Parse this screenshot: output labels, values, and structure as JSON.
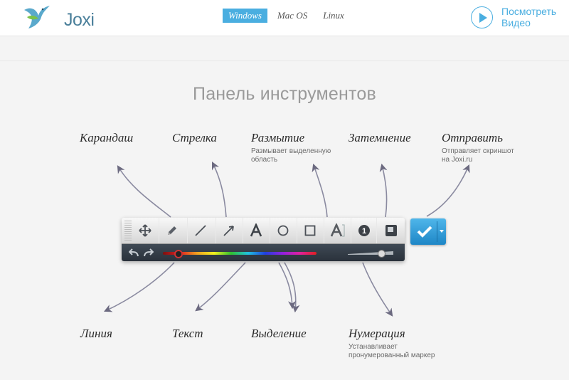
{
  "header": {
    "logo_text": "Joxi",
    "nav": [
      "Windows",
      "Mac OS",
      "Linux"
    ],
    "nav_active": "Windows",
    "video_label": "Посмотреть Видео"
  },
  "section_title": "Панель инструментов",
  "tools_top": [
    {
      "label": "Карандаш",
      "desc": ""
    },
    {
      "label": "Стрелка",
      "desc": ""
    },
    {
      "label": "Размытие",
      "desc": "Размывает выделенную область"
    },
    {
      "label": "Затемнение",
      "desc": ""
    },
    {
      "label": "Отправить",
      "desc": "Отправляет скриншот на Joxi.ru"
    }
  ],
  "tools_bottom": [
    {
      "label": "Линия",
      "desc": ""
    },
    {
      "label": "Текст",
      "desc": ""
    },
    {
      "label": "Выделение",
      "desc": ""
    },
    {
      "label": "Нумерация",
      "desc": "Устанавливает пронумерованный маркер"
    }
  ],
  "toolbar_icons": [
    "move-icon",
    "pencil-icon",
    "line-icon",
    "arrow-icon",
    "text-icon",
    "ellipse-icon",
    "rectangle-icon",
    "blur-text-icon",
    "numbering-icon",
    "darken-icon"
  ],
  "numbering_value": "1",
  "colors": {
    "accent": "#4aaee0",
    "toolbar_dark": "#2f3841",
    "confirm": "#2a96d6"
  }
}
